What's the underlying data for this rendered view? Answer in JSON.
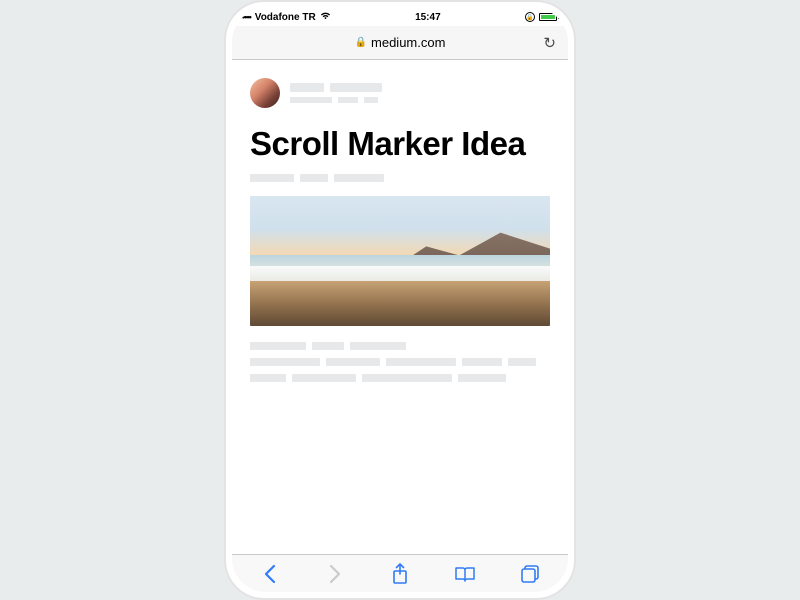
{
  "status": {
    "signal_dots": "•••••",
    "carrier": "Vodafone TR",
    "wifi": "wifi-icon",
    "time": "15:47",
    "orientation_lock": "orientation-lock-icon",
    "battery_pct": 95
  },
  "browser": {
    "domain": "medium.com",
    "secure": true
  },
  "article": {
    "title": "Scroll Marker Idea"
  },
  "colors": {
    "ios_blue": "#2f7cf6",
    "ios_grey": "#b8b9bd",
    "battery_green": "#3fcb49"
  }
}
